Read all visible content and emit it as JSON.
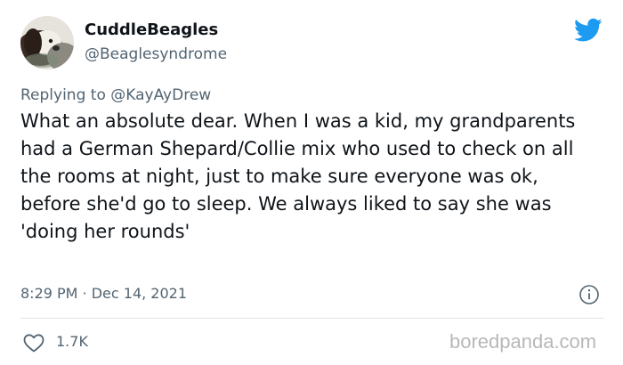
{
  "user": {
    "display_name": "CuddleBeagles",
    "handle": "@Beaglesyndrome",
    "avatar_icon": "beagle-avatar"
  },
  "reply": {
    "prefix": "Replying to ",
    "mention": "@KayAyDrew"
  },
  "tweet": {
    "text": "What an absolute dear. When I was a kid, my grandparents had a German Shepard/Collie mix who used to check on all the rooms at night, just to make sure everyone was ok, before she'd go to sleep. We always liked to say she was 'doing her rounds'",
    "timestamp": "8:29 PM · Dec 14, 2021",
    "likes": "1.7K"
  },
  "icons": {
    "logo": "twitter-bird-icon",
    "info": "info-icon",
    "like": "heart-icon"
  },
  "colors": {
    "twitter_blue": "#1d9bf0",
    "secondary_text": "#536471",
    "primary_text": "#0f1419"
  },
  "watermark": "boredpanda.com"
}
